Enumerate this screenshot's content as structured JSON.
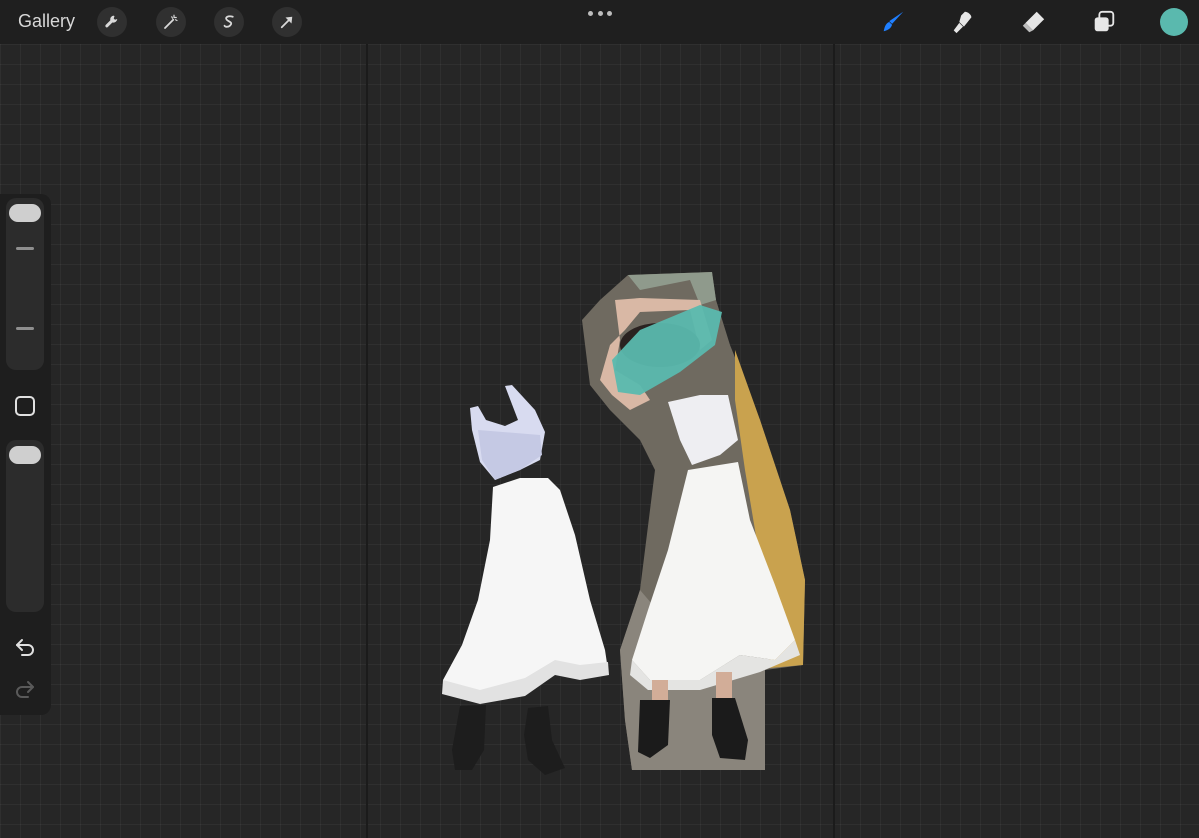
{
  "topbar": {
    "gallery_label": "Gallery",
    "left_tools": [
      "wrench-icon",
      "magic-wand-icon",
      "selection-s-icon",
      "transform-arrow-icon"
    ],
    "right_tools": [
      "brush-icon",
      "smudge-icon",
      "eraser-icon",
      "layers-icon"
    ],
    "active_tool": "brush-icon",
    "current_color": "#5ab9ae"
  },
  "sidebar": {
    "brush_size_icon": "slider-handle",
    "opacity_icon": "slider-handle",
    "modify_icon": "square-icon",
    "undo_icon": "undo-arrow-icon",
    "redo_icon": "redo-arrow-icon"
  },
  "canvas": {
    "background": "#262626",
    "content": [
      "cropped-top-cutout",
      "ruffle-skirt-cutout",
      "boots-cutout",
      "model-photo-cutout",
      "teal-paint-stroke"
    ]
  },
  "colors": {
    "accent_brush": "#1f7fff",
    "teal": "#5ab9ae"
  }
}
